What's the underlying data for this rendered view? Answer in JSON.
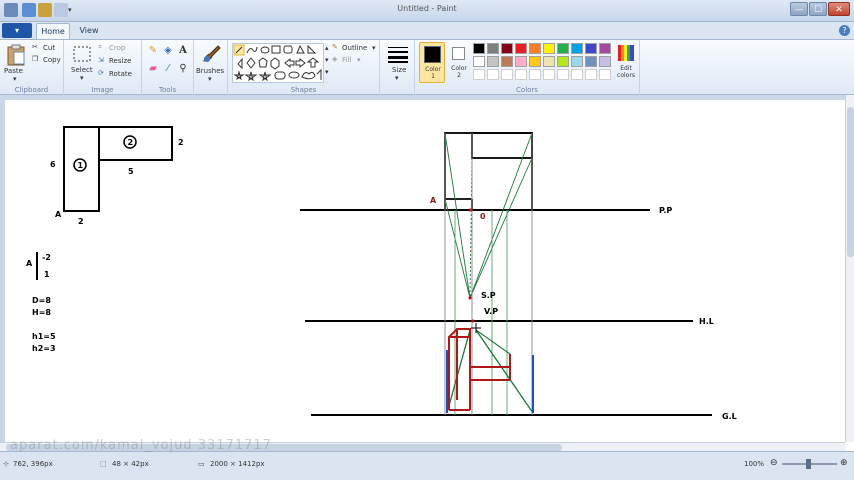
{
  "window": {
    "title": "Untitled - Paint",
    "controls": {
      "minimize": "—",
      "maximize": "☐",
      "close": "✕"
    }
  },
  "ribbon": {
    "file_menu": "▾",
    "tabs": [
      {
        "label": "Home",
        "active": true
      },
      {
        "label": "View",
        "active": false
      }
    ],
    "clipboard": {
      "paste": "Paste",
      "cut": "Cut",
      "copy": "Copy",
      "group": "Clipboard"
    },
    "image": {
      "select": "Select",
      "crop": "Crop",
      "resize": "Resize",
      "rotate": "Rotate",
      "group": "Image"
    },
    "tools": {
      "group": "Tools"
    },
    "brushes": {
      "label": "Brushes"
    },
    "shapes": {
      "outline": "Outline",
      "fill": "Fill",
      "group": "Shapes"
    },
    "size": {
      "label": "Size"
    },
    "colors": {
      "color1_label": "Color 1",
      "color2_label": "Color 2",
      "edit_label": "Edit colors",
      "group": "Colors",
      "color1": "#000000",
      "color2": "#ffffff",
      "palette_row1": [
        "#000000",
        "#7f7f7f",
        "#880015",
        "#ed1c24",
        "#ff7f27",
        "#fff200",
        "#22b14c",
        "#00a2e8",
        "#3f48cc",
        "#a349a4"
      ],
      "palette_row2": [
        "#ffffff",
        "#c3c3c3",
        "#b97a57",
        "#ffaec9",
        "#ffc90e",
        "#efe4b0",
        "#b5e61d",
        "#99d9ea",
        "#7092be",
        "#c8bfe7"
      ]
    }
  },
  "drawing": {
    "plan": {
      "label_1": "1",
      "label_2": "2",
      "dim_6": "6",
      "dim_2_right": "2",
      "dim_5": "5",
      "dim_2_bottom": "2",
      "point_a": "A"
    },
    "notes": {
      "a_label": "A",
      "a_top": "-2",
      "a_bottom": "1",
      "d": "D=8",
      "h": "H=8",
      "h1": "h1=5",
      "h2": "h2=3"
    },
    "perspective": {
      "pp": "P.P",
      "hl": "H.L",
      "gl": "G.L",
      "sp": "S.P",
      "vp": "V.P",
      "a": "A",
      "zero": "0"
    }
  },
  "status": {
    "cursor_pos": "762, 396px",
    "selection_size": "48 × 42px",
    "image_size": "2000 × 1412px",
    "zoom": "100%",
    "watermark": "aparat.com/kamal_vojud   33171717"
  }
}
